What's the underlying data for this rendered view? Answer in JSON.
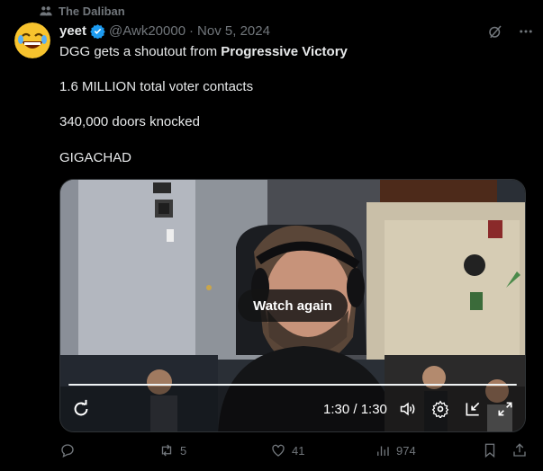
{
  "social_context": {
    "label": "The Daliban",
    "icon": "community-icon"
  },
  "author": {
    "name": "yeet",
    "handle": "@Awk20000",
    "separator": "·",
    "date": "Nov 5, 2024",
    "verified": true,
    "avatar_icon": "laughing-emoji-avatar"
  },
  "tweet": {
    "line1_pre": "DGG gets a shoutout from ",
    "line1_bold": "Progressive Victory",
    "line2": "1.6 MILLION total voter contacts",
    "line3": "340,000 doors knocked",
    "line4": "GIGACHAD"
  },
  "media": {
    "overlay_button": "Watch again",
    "time": "1:30 / 1:30",
    "progress_fraction": 1.0
  },
  "actions": {
    "reply_count": "",
    "repost_count": "5",
    "like_count": "41",
    "views_count": "974"
  },
  "colors": {
    "accent": "#1d9bf0",
    "muted": "#71767b",
    "text": "#e7e9ea",
    "background": "#000000"
  }
}
